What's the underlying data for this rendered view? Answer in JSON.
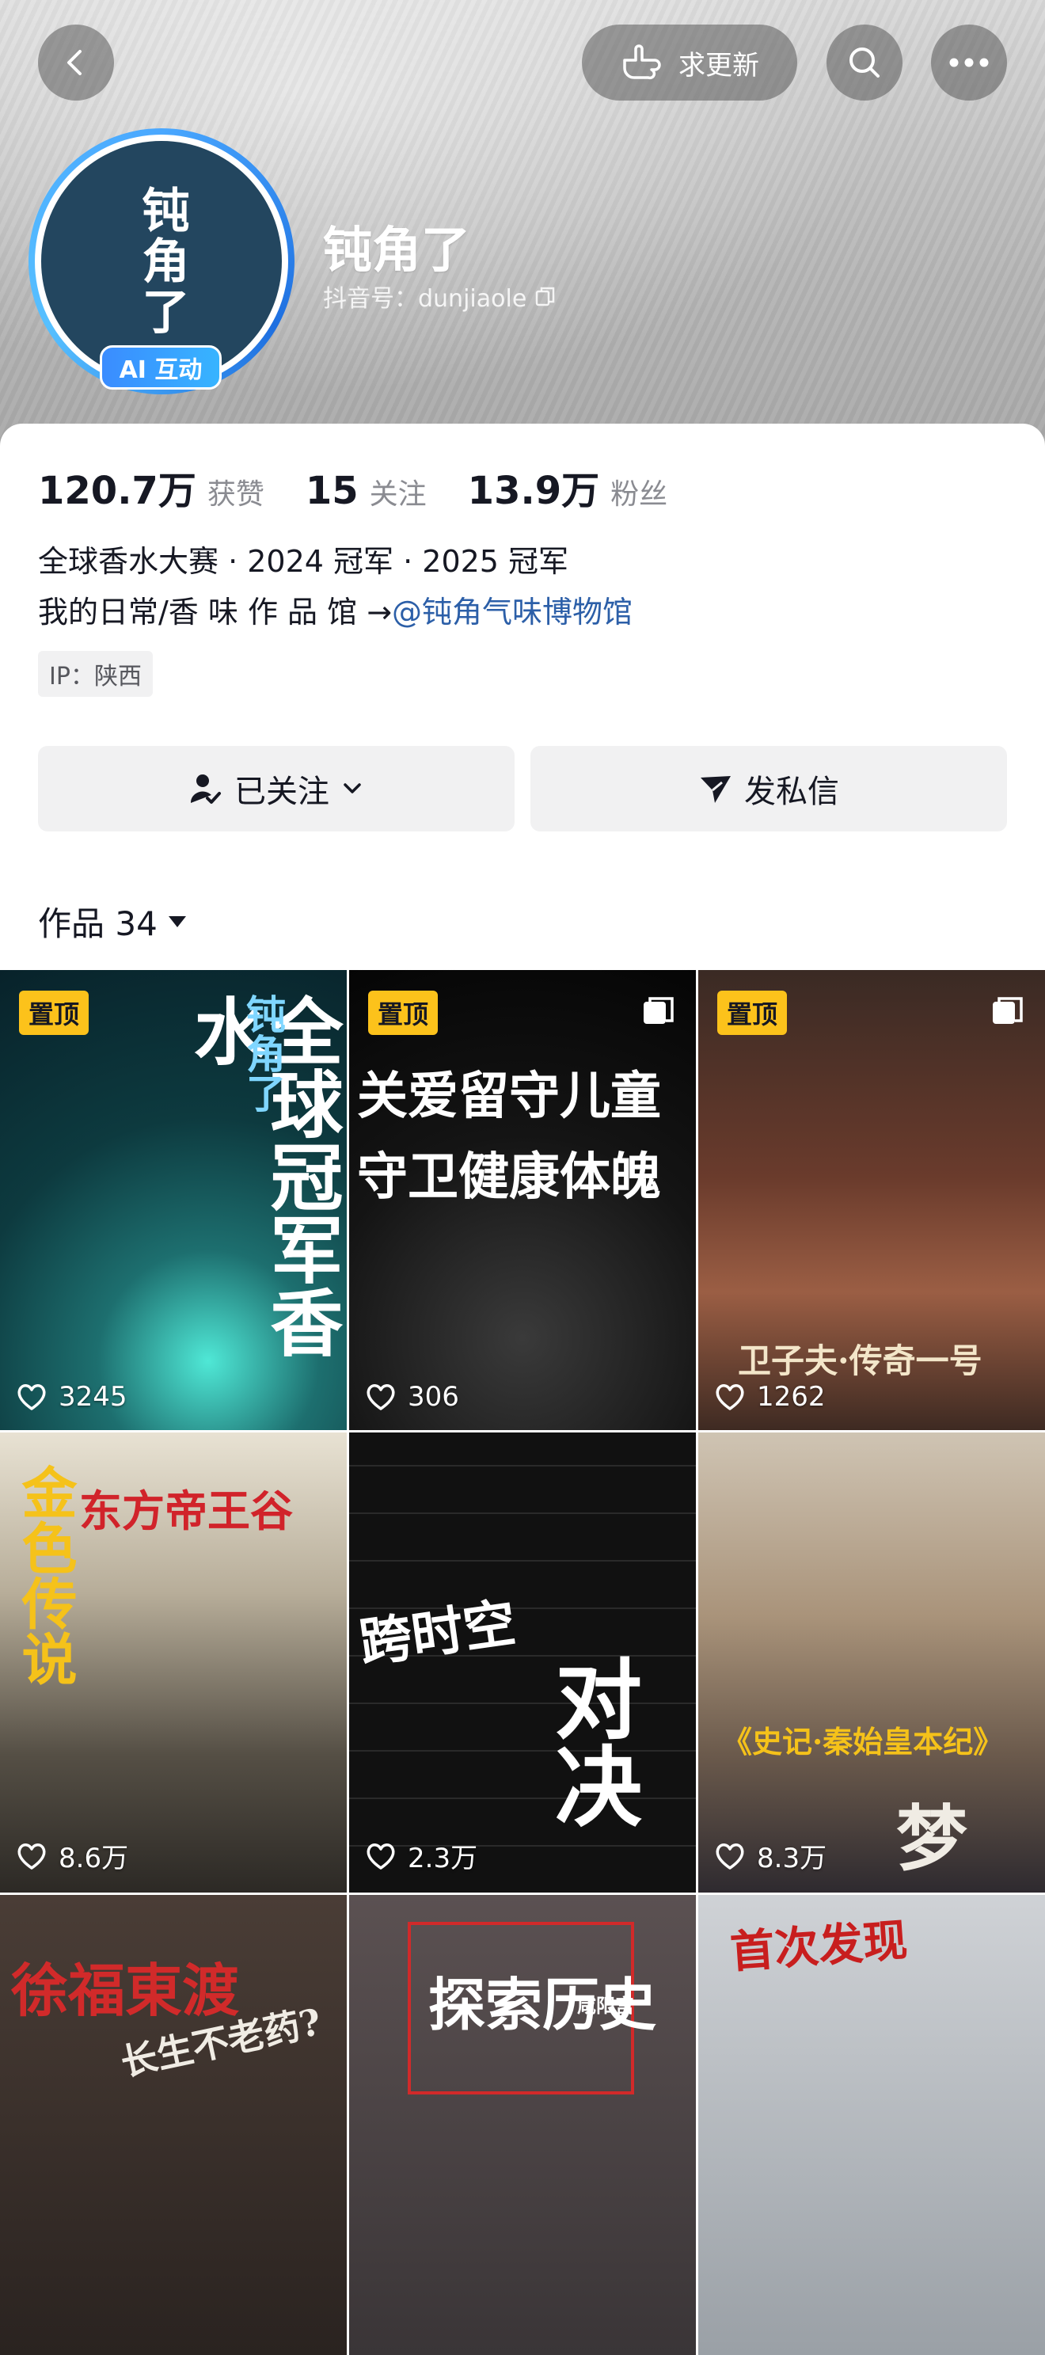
{
  "nav": {
    "back_icon": "back-chevron-icon",
    "request_update_label": "求更新",
    "search_icon": "search-icon",
    "more_icon": "more-dots-icon"
  },
  "profile": {
    "avatar_text": "钝角了",
    "ai_badge": "AI 互动",
    "nickname": "钝角了",
    "douyin_id": "抖音号：dunjiaole"
  },
  "stats": [
    {
      "value": "120.7万",
      "label": "获赞"
    },
    {
      "value": "15",
      "label": "关注"
    },
    {
      "value": "13.9万",
      "label": "粉丝"
    }
  ],
  "bio": {
    "line1": "全球香水大赛 · 2024 冠军 · 2025 冠军",
    "line2_prefix": "我的日常/香 味 作 品 馆 →",
    "line2_link": "@钝角气味博物馆"
  },
  "ip": "IP：陕西",
  "actions": {
    "follow_label": "已关注",
    "message_label": "发私信"
  },
  "works": {
    "title": "作品 34"
  },
  "videos": [
    {
      "pinned": "置顶",
      "likes": "3245",
      "cover_main": "全球冠军香水",
      "cover_side": "钝角了",
      "multi": false
    },
    {
      "pinned": "置顶",
      "likes": "306",
      "cover_main": "关爱留守儿童",
      "cover_side": "守卫健康体魄",
      "multi": true
    },
    {
      "pinned": "置顶",
      "likes": "1262",
      "cover_main": "卫子夫·传奇一号",
      "cover_side": "",
      "multi": true
    },
    {
      "pinned": "",
      "likes": "8.6万",
      "cover_main": "东方帝王谷",
      "cover_side": "金色传说",
      "multi": false
    },
    {
      "pinned": "",
      "likes": "2.3万",
      "cover_main": "跨时空",
      "cover_side": "对决",
      "multi": false
    },
    {
      "pinned": "",
      "likes": "8.3万",
      "cover_main": "《史记·秦始皇本纪》",
      "cover_side": "梦",
      "multi": false
    },
    {
      "pinned": "",
      "likes": "",
      "cover_main": "徐福東渡",
      "cover_side": "长生不老药?",
      "multi": false
    },
    {
      "pinned": "",
      "likes": "",
      "cover_main": "探索历史",
      "cover_side": "咸阳宫",
      "multi": false
    },
    {
      "pinned": "",
      "likes": "",
      "cover_main": "首次发现",
      "cover_side": "",
      "multi": false
    }
  ]
}
